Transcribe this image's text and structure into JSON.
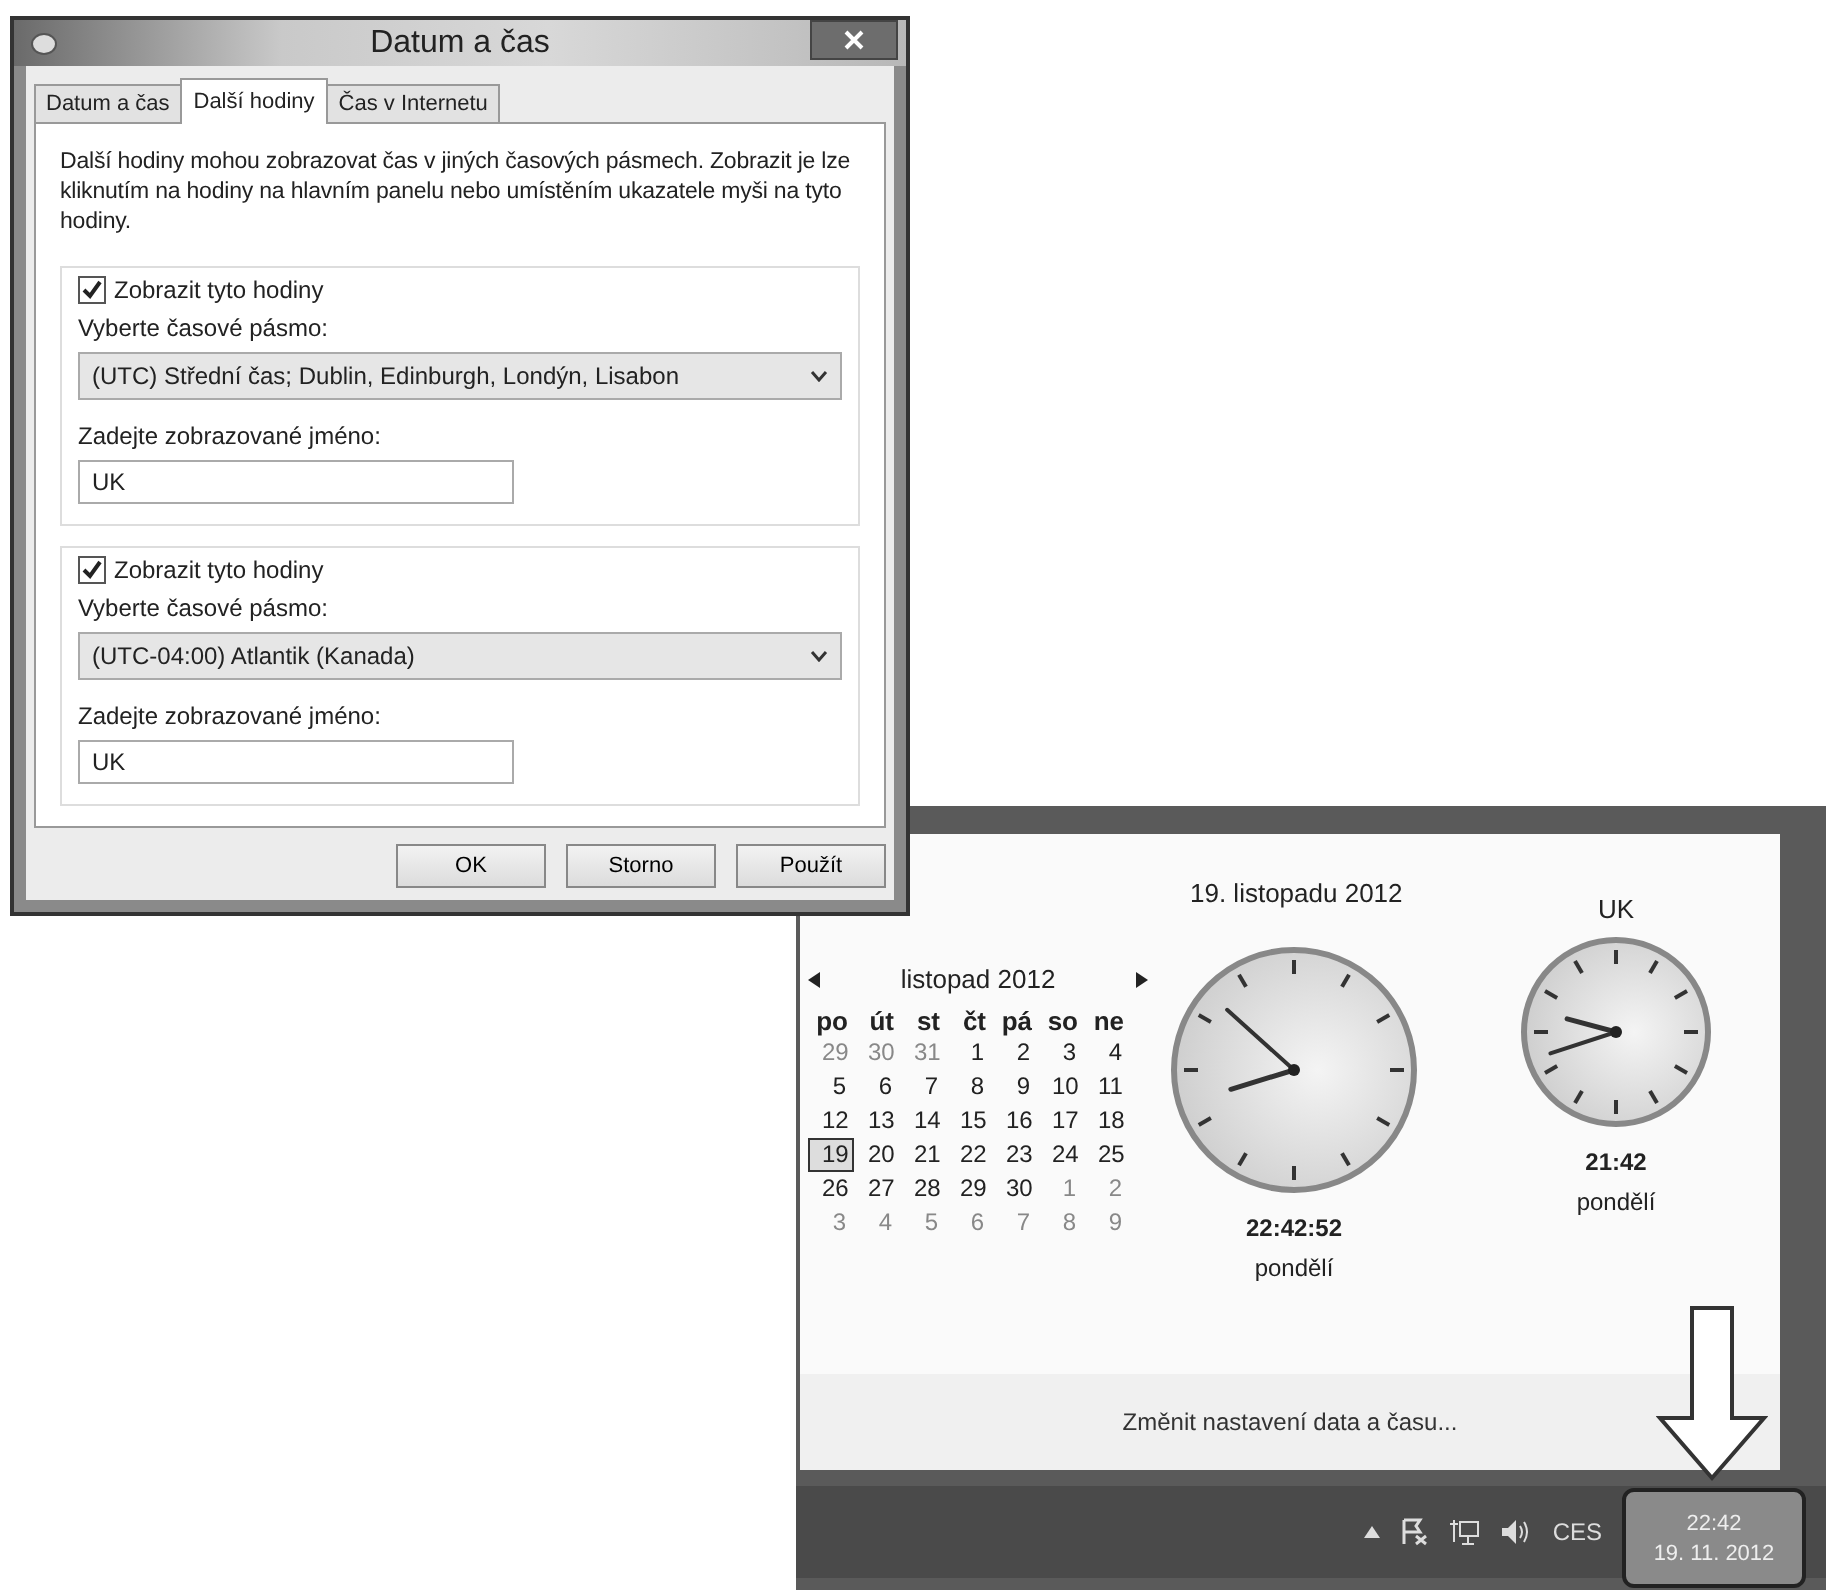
{
  "window": {
    "title": "Datum a čas"
  },
  "tabs": [
    {
      "label": "Datum a čas",
      "selected": false
    },
    {
      "label": "Další hodiny",
      "selected": true
    },
    {
      "label": "Čas v Internetu",
      "selected": false
    }
  ],
  "description": "Další hodiny mohou zobrazovat čas v jiných časových pásmech. Zobrazit je lze kliknutím na hodiny na hlavním panelu nebo umístěním ukazatele myši na tyto hodiny.",
  "clock_groups": [
    {
      "checked": true,
      "label": "Zobrazit tyto hodiny",
      "timezone_label": "Vyberte časové pásmo:",
      "timezone": "(UTC) Střední čas; Dublin, Edinburgh, Londýn, Lisabon",
      "name_label": "Zadejte zobrazované jméno:",
      "name": "UK"
    },
    {
      "checked": true,
      "label": "Zobrazit tyto hodiny",
      "timezone_label": "Vyberte časové pásmo:",
      "timezone": "(UTC-04:00) Atlantik (Kanada)",
      "name_label": "Zadejte zobrazované jméno:",
      "name": "UK"
    }
  ],
  "buttons": [
    "OK",
    "Storno",
    "Použít"
  ],
  "flyout": {
    "date_title": "19. listopadu 2012",
    "calendar": {
      "month": "listopad 2012",
      "weekdays": [
        "po",
        "út",
        "st",
        "čt",
        "pá",
        "so",
        "ne"
      ],
      "weeks": [
        [
          {
            "day": "29",
            "other_month": true,
            "selected": false
          },
          {
            "day": "30",
            "other_month": true,
            "selected": false
          },
          {
            "day": "31",
            "other_month": true,
            "selected": false
          },
          {
            "day": "1",
            "other_month": false,
            "selected": false
          },
          {
            "day": "2",
            "other_month": false,
            "selected": false
          },
          {
            "day": "3",
            "other_month": false,
            "selected": false
          },
          {
            "day": "4",
            "other_month": false,
            "selected": false
          }
        ],
        [
          {
            "day": "5",
            "other_month": false,
            "selected": false
          },
          {
            "day": "6",
            "other_month": false,
            "selected": false
          },
          {
            "day": "7",
            "other_month": false,
            "selected": false
          },
          {
            "day": "8",
            "other_month": false,
            "selected": false
          },
          {
            "day": "9",
            "other_month": false,
            "selected": false
          },
          {
            "day": "10",
            "other_month": false,
            "selected": false
          },
          {
            "day": "11",
            "other_month": false,
            "selected": false
          }
        ],
        [
          {
            "day": "12",
            "other_month": false,
            "selected": false
          },
          {
            "day": "13",
            "other_month": false,
            "selected": false
          },
          {
            "day": "14",
            "other_month": false,
            "selected": false
          },
          {
            "day": "15",
            "other_month": false,
            "selected": false
          },
          {
            "day": "16",
            "other_month": false,
            "selected": false
          },
          {
            "day": "17",
            "other_month": false,
            "selected": false
          },
          {
            "day": "18",
            "other_month": false,
            "selected": false
          }
        ],
        [
          {
            "day": "19",
            "other_month": false,
            "selected": true
          },
          {
            "day": "20",
            "other_month": false,
            "selected": false
          },
          {
            "day": "21",
            "other_month": false,
            "selected": false
          },
          {
            "day": "22",
            "other_month": false,
            "selected": false
          },
          {
            "day": "23",
            "other_month": false,
            "selected": false
          },
          {
            "day": "24",
            "other_month": false,
            "selected": false
          },
          {
            "day": "25",
            "other_month": false,
            "selected": false
          }
        ],
        [
          {
            "day": "26",
            "other_month": false,
            "selected": false
          },
          {
            "day": "27",
            "other_month": false,
            "selected": false
          },
          {
            "day": "28",
            "other_month": false,
            "selected": false
          },
          {
            "day": "29",
            "other_month": false,
            "selected": false
          },
          {
            "day": "30",
            "other_month": false,
            "selected": false
          },
          {
            "day": "1",
            "other_month": true,
            "selected": false
          },
          {
            "day": "2",
            "other_month": true,
            "selected": false
          }
        ],
        [
          {
            "day": "3",
            "other_month": true,
            "selected": false
          },
          {
            "day": "4",
            "other_month": true,
            "selected": false
          },
          {
            "day": "5",
            "other_month": true,
            "selected": false
          },
          {
            "day": "6",
            "other_month": true,
            "selected": false
          },
          {
            "day": "7",
            "other_month": true,
            "selected": false
          },
          {
            "day": "8",
            "other_month": true,
            "selected": false
          },
          {
            "day": "9",
            "other_month": true,
            "selected": false
          }
        ]
      ]
    },
    "clocks": [
      {
        "time": "22:42:52",
        "weekday": "pondělí"
      },
      {
        "caption": "UK",
        "time": "21:42",
        "weekday": "pondělí"
      }
    ],
    "link": "Změnit nastavení data a času..."
  },
  "taskbar": {
    "language": "CES",
    "time": "22:42",
    "date": "19. 11. 2012"
  }
}
